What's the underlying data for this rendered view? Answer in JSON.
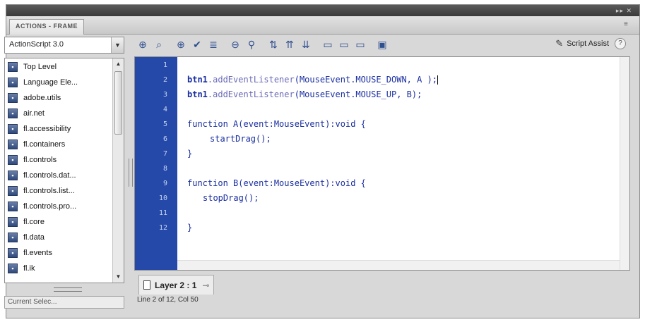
{
  "panel": {
    "tab_label": "ACTIONS - FRAME"
  },
  "left_panel": {
    "version_select": "ActionScript 3.0",
    "tree_items": [
      "Top Level",
      "Language Ele...",
      "adobe.utils",
      "air.net",
      "fl.accessibility",
      "fl.containers",
      "fl.controls",
      "fl.controls.dat...",
      "fl.controls.list...",
      "fl.controls.pro...",
      "fl.core",
      "fl.data",
      "fl.events",
      "fl.ik"
    ],
    "current_selection": "Current Selec..."
  },
  "toolbar": {
    "icons": [
      "add-script-icon",
      "find-icon",
      "target-icon",
      "check-syntax-icon",
      "auto-format-icon",
      "code-hint-icon",
      "debug-options-icon",
      "collapse-between-icon",
      "collapse-selection-icon",
      "expand-all-icon",
      "comment-block-icon",
      "comment-line-icon",
      "uncomment-icon",
      "show-hide-toolbox-icon"
    ],
    "script_assist_label": "Script Assist",
    "help_label": "?"
  },
  "editor": {
    "line_numbers": [
      "1",
      "2",
      "3",
      "4",
      "5",
      "6",
      "7",
      "8",
      "9",
      "10",
      "11",
      "12"
    ],
    "lines": {
      "l2a": "btn1",
      "l2b": ".addEventListener",
      "l2c": "(MouseEvent.MOUSE_DOWN, A );",
      "l3a": "btn1",
      "l3b": ".addEventListener",
      "l3c": "(MouseEvent.MOUSE_UP, B);",
      "l5": "function A(event:MouseEvent):void {",
      "l6": "startDrag();",
      "l7": "}",
      "l9": "function B(event:MouseEvent):void {",
      "l10": "stopDrag();",
      "l12": "}"
    }
  },
  "footer": {
    "layer_tab": "Layer 2 : 1",
    "status": "Line 2 of 12, Col 50"
  },
  "colors": {
    "gutter": "#2449a8",
    "keyword": "#1a2fa0",
    "identifier": "#6b6bb8"
  }
}
